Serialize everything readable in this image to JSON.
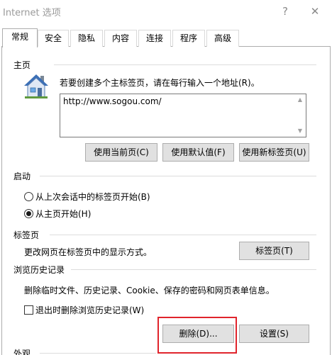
{
  "window": {
    "title": "Internet 选项",
    "help_glyph": "?",
    "close_glyph": "✕"
  },
  "tabs": [
    {
      "label": "常规",
      "active": true
    },
    {
      "label": "安全",
      "active": false
    },
    {
      "label": "隐私",
      "active": false
    },
    {
      "label": "内容",
      "active": false
    },
    {
      "label": "连接",
      "active": false
    },
    {
      "label": "程序",
      "active": false
    },
    {
      "label": "高级",
      "active": false
    }
  ],
  "homepage": {
    "header": "主页",
    "instruction": "若要创建多个主标签页，请在每行输入一个地址(R)。",
    "url_value": "http://www.sogou.com/",
    "icon": "house-icon",
    "buttons": {
      "use_current": "使用当前页(C)",
      "use_default": "使用默认值(F)",
      "use_new_tab": "使用新标签页(U)"
    }
  },
  "startup": {
    "header": "启动",
    "options": [
      {
        "label": "从上次会话中的标签页开始(B)",
        "selected": false
      },
      {
        "label": "从主页开始(H)",
        "selected": true
      }
    ]
  },
  "tabs_section": {
    "header": "标签页",
    "description": "更改网页在标签页中的显示方式。",
    "button": "标签页(T)"
  },
  "history": {
    "header": "浏览历史记录",
    "description": "删除临时文件、历史记录、Cookie、保存的密码和网页表单信息。",
    "checkbox_label": "退出时删除浏览历史记录(W)",
    "checkbox_checked": false,
    "delete_button": "删除(D)...",
    "settings_button": "设置(S)"
  },
  "appearance": {
    "header": "外观"
  },
  "colors": {
    "highlight": "#e0242c",
    "border": "#adadad",
    "button_face": "#e1e1e1"
  }
}
